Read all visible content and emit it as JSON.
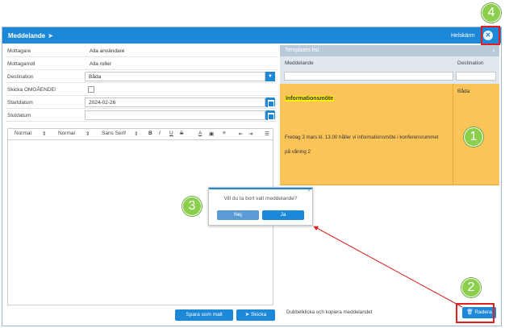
{
  "window": {
    "title": "Meddelande",
    "fullscreen_label": "Helskärm",
    "close_glyph": "✕"
  },
  "form": {
    "rows": [
      {
        "label": "Mottagare",
        "value": "Alla användare"
      },
      {
        "label": "Mottagarroll",
        "value": "Alla roller"
      },
      {
        "label": "Destination",
        "value": "Båda"
      },
      {
        "label": "Skicka OMGÅENDE!",
        "value": ""
      },
      {
        "label": "Startdatum",
        "value": "2024-02-26"
      },
      {
        "label": "Slutdatum",
        "value": ""
      }
    ]
  },
  "toolbar": {
    "header_select": "Normal",
    "size_select": "Normal",
    "font_select": "Sans Serif",
    "bold": "B",
    "italic": "I",
    "underline": "U",
    "strike": "S"
  },
  "buttons": {
    "save_template": "Spara som mall",
    "send": "Skicka",
    "delete": "Radera"
  },
  "templates": {
    "title": "Templates list",
    "col_message": "Meddelande",
    "col_destination": "Destination",
    "row": {
      "name": "Informationsmöte",
      "destination": "Båda",
      "body_line1": "Fredag 3 mars kl. 13.00 håller vi informationsmöte i konferensrummet",
      "body_line2": "på våning 2"
    },
    "footer_hint": "Dubbelklicka och kopiera meddelandet"
  },
  "dialog": {
    "question": "Vill du ta bort valt meddelande?",
    "no": "Nej",
    "yes": "Ja"
  },
  "annotations": {
    "markers": [
      "1",
      "2",
      "3",
      "4"
    ],
    "marker_color": "#8ccf4d",
    "highlight_color": "#e02020"
  },
  "colors": {
    "accent": "#1e88d8",
    "selected_row": "#fbc459",
    "name_highlight": "#fff200"
  }
}
